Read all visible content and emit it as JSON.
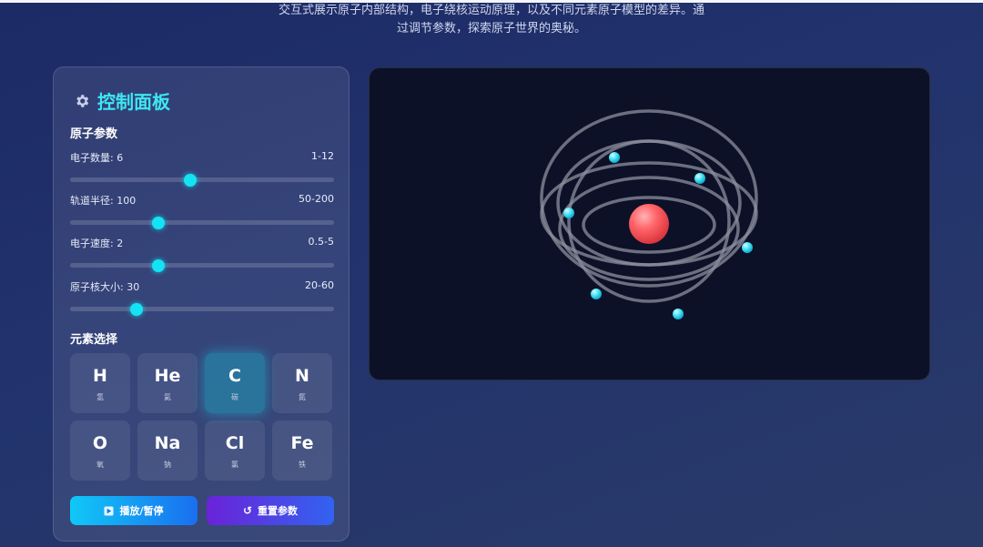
{
  "intro": {
    "line1": "交互式展示原子内部结构，电子绕核运动原理，以及不同元素原子模型的差异。通",
    "line2": "过调节参数，探索原子世界的奥秘。"
  },
  "panel": {
    "title": "控制面板",
    "atom_params_label": "原子参数",
    "sliders": [
      {
        "label": "电子数量: 6",
        "range": "1-12",
        "value": 6,
        "min": 1,
        "max": 12
      },
      {
        "label": "轨道半径: 100",
        "range": "50-200",
        "value": 100,
        "min": 50,
        "max": 200
      },
      {
        "label": "电子速度: 2",
        "range": "0.5-5",
        "value": 2,
        "min": 0.5,
        "max": 5
      },
      {
        "label": "原子核大小: 30",
        "range": "20-60",
        "value": 30,
        "min": 20,
        "max": 60
      }
    ],
    "element_label": "元素选择",
    "elements": [
      {
        "symbol": "H",
        "name": "氢"
      },
      {
        "symbol": "He",
        "name": "氦"
      },
      {
        "symbol": "C",
        "name": "碳",
        "selected": true
      },
      {
        "symbol": "N",
        "name": "氮"
      },
      {
        "symbol": "O",
        "name": "氧"
      },
      {
        "symbol": "Na",
        "name": "钠"
      },
      {
        "symbol": "Cl",
        "name": "氯"
      },
      {
        "symbol": "Fe",
        "name": "铁"
      }
    ],
    "play_button": "播放/暂停",
    "reset_button": "重置参数"
  },
  "colors": {
    "accent": "#3ee6f0",
    "nucleus": "#ff5a5f",
    "electron": "#3fe0f5"
  }
}
